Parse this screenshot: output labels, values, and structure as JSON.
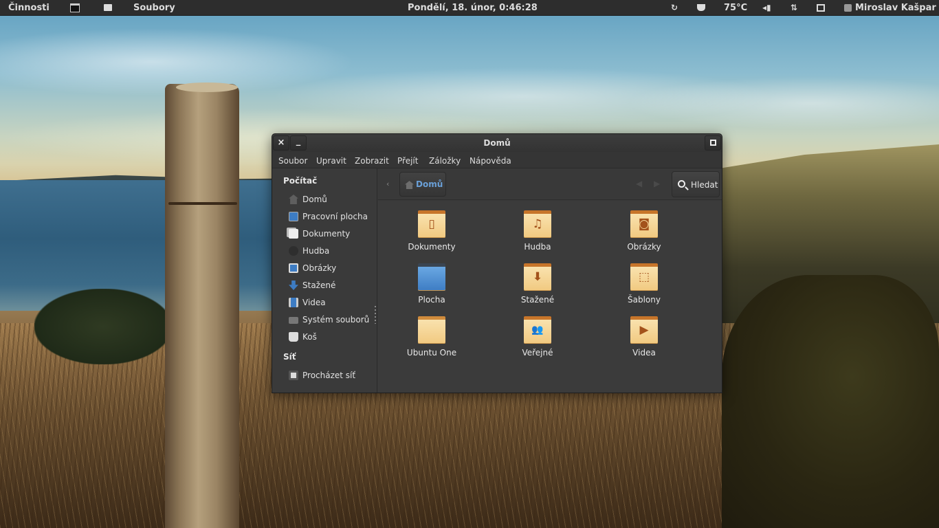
{
  "top_panel": {
    "activities": "Činnosti",
    "app_name": "Soubory",
    "clock": "Pondělí, 18. únor,  0:46:28",
    "temperature": "75°C",
    "user": "Miroslav Kašpar",
    "icons": [
      "terminal-icon",
      "files-icon",
      "refresh-icon",
      "cup-icon",
      "volume-icon",
      "network-icon",
      "battery-icon",
      "user-icon"
    ]
  },
  "window": {
    "title": "Domů",
    "close_label": "×",
    "minimize_label": "_",
    "menu": [
      "Soubor",
      "Upravit",
      "Zobrazit",
      "Přejít",
      "Záložky",
      "Nápověda"
    ]
  },
  "sidebar": {
    "computer_header": "Počítač",
    "computer_items": [
      {
        "label": "Domů",
        "icon": "home-icon"
      },
      {
        "label": "Pracovní plocha",
        "icon": "desktop-icon"
      },
      {
        "label": "Dokumenty",
        "icon": "documents-icon"
      },
      {
        "label": "Hudba",
        "icon": "music-icon"
      },
      {
        "label": "Obrázky",
        "icon": "pictures-icon"
      },
      {
        "label": "Stažené",
        "icon": "downloads-icon"
      },
      {
        "label": "Videa",
        "icon": "videos-icon"
      },
      {
        "label": "Systém souborů",
        "icon": "filesystem-icon"
      },
      {
        "label": "Koš",
        "icon": "trash-icon"
      }
    ],
    "network_header": "Síť",
    "network_items": [
      {
        "label": "Procházet síť",
        "icon": "network-browse-icon"
      }
    ]
  },
  "toolbar": {
    "breadcrumb": "Domů",
    "search_label": "Hledat"
  },
  "files": [
    {
      "name": "Dokumenty",
      "icon": "documents-folder-icon",
      "glyph": "▯"
    },
    {
      "name": "Hudba",
      "icon": "music-folder-icon",
      "glyph": "♫"
    },
    {
      "name": "Obrázky",
      "icon": "pictures-folder-icon",
      "glyph": "◙"
    },
    {
      "name": "Plocha",
      "icon": "desktop-folder-icon",
      "glyph": ""
    },
    {
      "name": "Stažené",
      "icon": "downloads-folder-icon",
      "glyph": "⬇"
    },
    {
      "name": "Šablony",
      "icon": "templates-folder-icon",
      "glyph": "⬚"
    },
    {
      "name": "Ubuntu One",
      "icon": "ubuntu-one-folder-icon",
      "glyph": ""
    },
    {
      "name": "Veřejné",
      "icon": "public-folder-icon",
      "glyph": "👥"
    },
    {
      "name": "Videa",
      "icon": "videos-folder-icon",
      "glyph": "▶"
    }
  ],
  "colors": {
    "panel": "#2d2d2d",
    "window_bg": "#393939",
    "breadcrumb_accent": "#6aa0d8",
    "folder_tab": "#c7752a",
    "folder_body": "#f1c980"
  }
}
